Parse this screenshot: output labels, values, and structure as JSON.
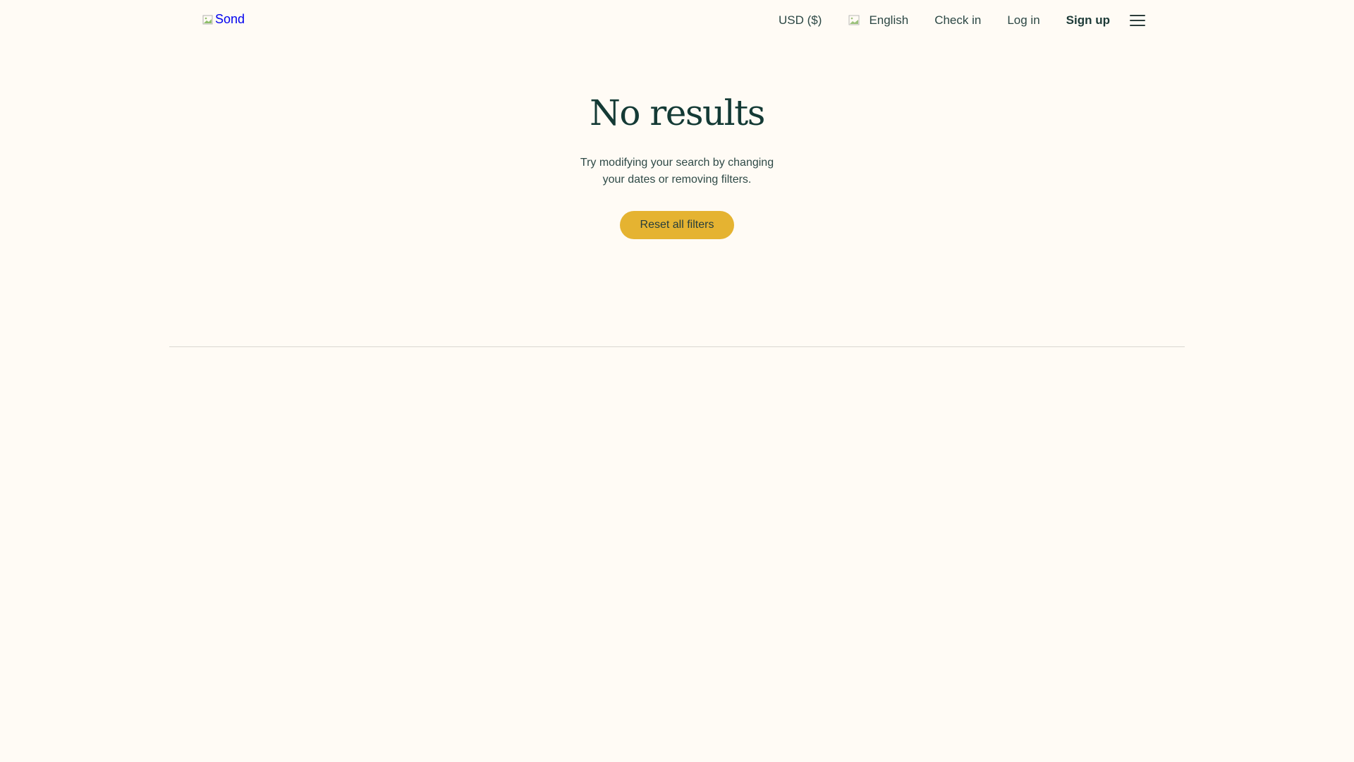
{
  "header": {
    "logo_alt": "Sond",
    "currency": "USD ($)",
    "language": "English",
    "check_in": "Check in",
    "log_in": "Log in",
    "sign_up": "Sign up"
  },
  "main": {
    "title": "No results",
    "subtitle": "Try modifying your search by changing your dates or removing filters.",
    "reset_button": "Reset all filters"
  },
  "colors": {
    "background": "#fffbf5",
    "primary_text": "#143a35",
    "button": "#e5b331",
    "logo_link": "#0000ee"
  },
  "icons": {
    "logo": "broken-image-icon",
    "language": "globe-icon",
    "menu": "hamburger-menu-icon"
  }
}
